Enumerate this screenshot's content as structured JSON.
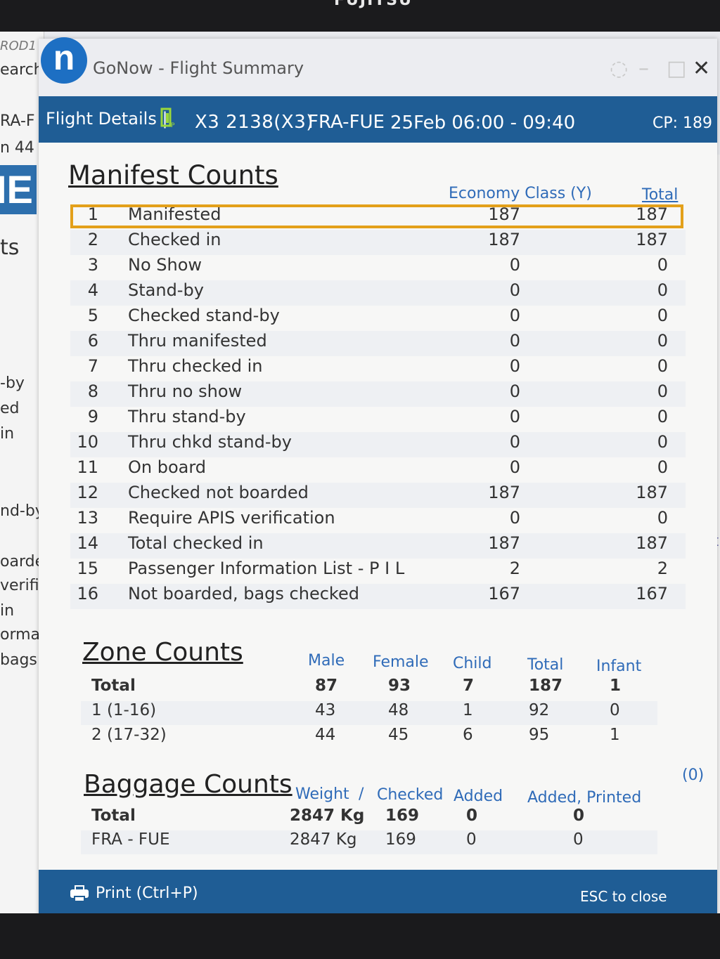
{
  "bezel": {
    "brand": "FUJITSU"
  },
  "background_app": {
    "fragments_left": [
      "ROD1",
      "earch",
      "RA-F",
      "n 44",
      "IE",
      "ts",
      "-by",
      "ed",
      "in",
      "nd-by",
      "oarde",
      "verific",
      "in",
      "ormat",
      "bags ("
    ],
    "fragment_right": "ent"
  },
  "window": {
    "logo_letter": "n",
    "title": "GoNow - Flight Summary",
    "close_glyph": "✕",
    "minimize_glyph": "–",
    "maximize_glyph": "□"
  },
  "header": {
    "label": "Flight Details |",
    "flight": "X3 2138(X3)",
    "route": "FRA-FUE",
    "datetime": "25Feb 06:00 - 09:40",
    "cp": "CP: 189"
  },
  "manifest": {
    "title": "Manifest Counts",
    "col_economy": "Economy Class (Y)",
    "col_total": "Total",
    "rows": [
      {
        "num": "1",
        "label": "Manifested",
        "economy": "187",
        "total": "187"
      },
      {
        "num": "2",
        "label": "Checked in",
        "economy": "187",
        "total": "187"
      },
      {
        "num": "3",
        "label": "No Show",
        "economy": "0",
        "total": "0"
      },
      {
        "num": "4",
        "label": "Stand-by",
        "economy": "0",
        "total": "0"
      },
      {
        "num": "5",
        "label": "Checked stand-by",
        "economy": "0",
        "total": "0"
      },
      {
        "num": "6",
        "label": "Thru manifested",
        "economy": "0",
        "total": "0"
      },
      {
        "num": "7",
        "label": "Thru checked in",
        "economy": "0",
        "total": "0"
      },
      {
        "num": "8",
        "label": "Thru no show",
        "economy": "0",
        "total": "0"
      },
      {
        "num": "9",
        "label": "Thru stand-by",
        "economy": "0",
        "total": "0"
      },
      {
        "num": "10",
        "label": "Thru chkd stand-by",
        "economy": "0",
        "total": "0"
      },
      {
        "num": "11",
        "label": "On board",
        "economy": "0",
        "total": "0"
      },
      {
        "num": "12",
        "label": "Checked not boarded",
        "economy": "187",
        "total": "187"
      },
      {
        "num": "13",
        "label": "Require APIS verification",
        "economy": "0",
        "total": "0"
      },
      {
        "num": "14",
        "label": "Total checked in",
        "economy": "187",
        "total": "187"
      },
      {
        "num": "15",
        "label": "Passenger Information List - P I L",
        "economy": "2",
        "total": "2"
      },
      {
        "num": "16",
        "label": "Not boarded, bags checked",
        "economy": "167",
        "total": "167"
      }
    ]
  },
  "zone": {
    "title": "Zone Counts",
    "columns": [
      "Male",
      "Female",
      "Child",
      "Total",
      "Infant"
    ],
    "rows": [
      {
        "label": "Total",
        "male": "87",
        "female": "93",
        "child": "7",
        "total": "187",
        "infant": "1"
      },
      {
        "label": "1 (1-16)",
        "male": "43",
        "female": "48",
        "child": "1",
        "total": "92",
        "infant": "0"
      },
      {
        "label": "2 (17-32)",
        "male": "44",
        "female": "45",
        "child": "6",
        "total": "95",
        "infant": "1"
      }
    ]
  },
  "baggage": {
    "title": "Baggage Counts",
    "col_weight": "Weight",
    "col_sep": "/",
    "col_checked": "Checked",
    "col_added": "Added",
    "col_added_printed": "Added, Printed",
    "side_count": "(0)",
    "rows": [
      {
        "label": "Total",
        "weight": "2847 Kg",
        "checked": "169",
        "added": "0",
        "added_printed": "0"
      },
      {
        "label": "FRA - FUE",
        "weight": "2847 Kg",
        "checked": "169",
        "added": "0",
        "added_printed": "0"
      }
    ]
  },
  "footer": {
    "print_label": "Print (Ctrl+P)",
    "esc_label": "ESC to close"
  },
  "colors": {
    "header_blue": "#1f5d95",
    "column_head_blue": "#2f6bb8",
    "highlight_orange": "#e3a01a",
    "logo_blue": "#1d6fc3"
  }
}
